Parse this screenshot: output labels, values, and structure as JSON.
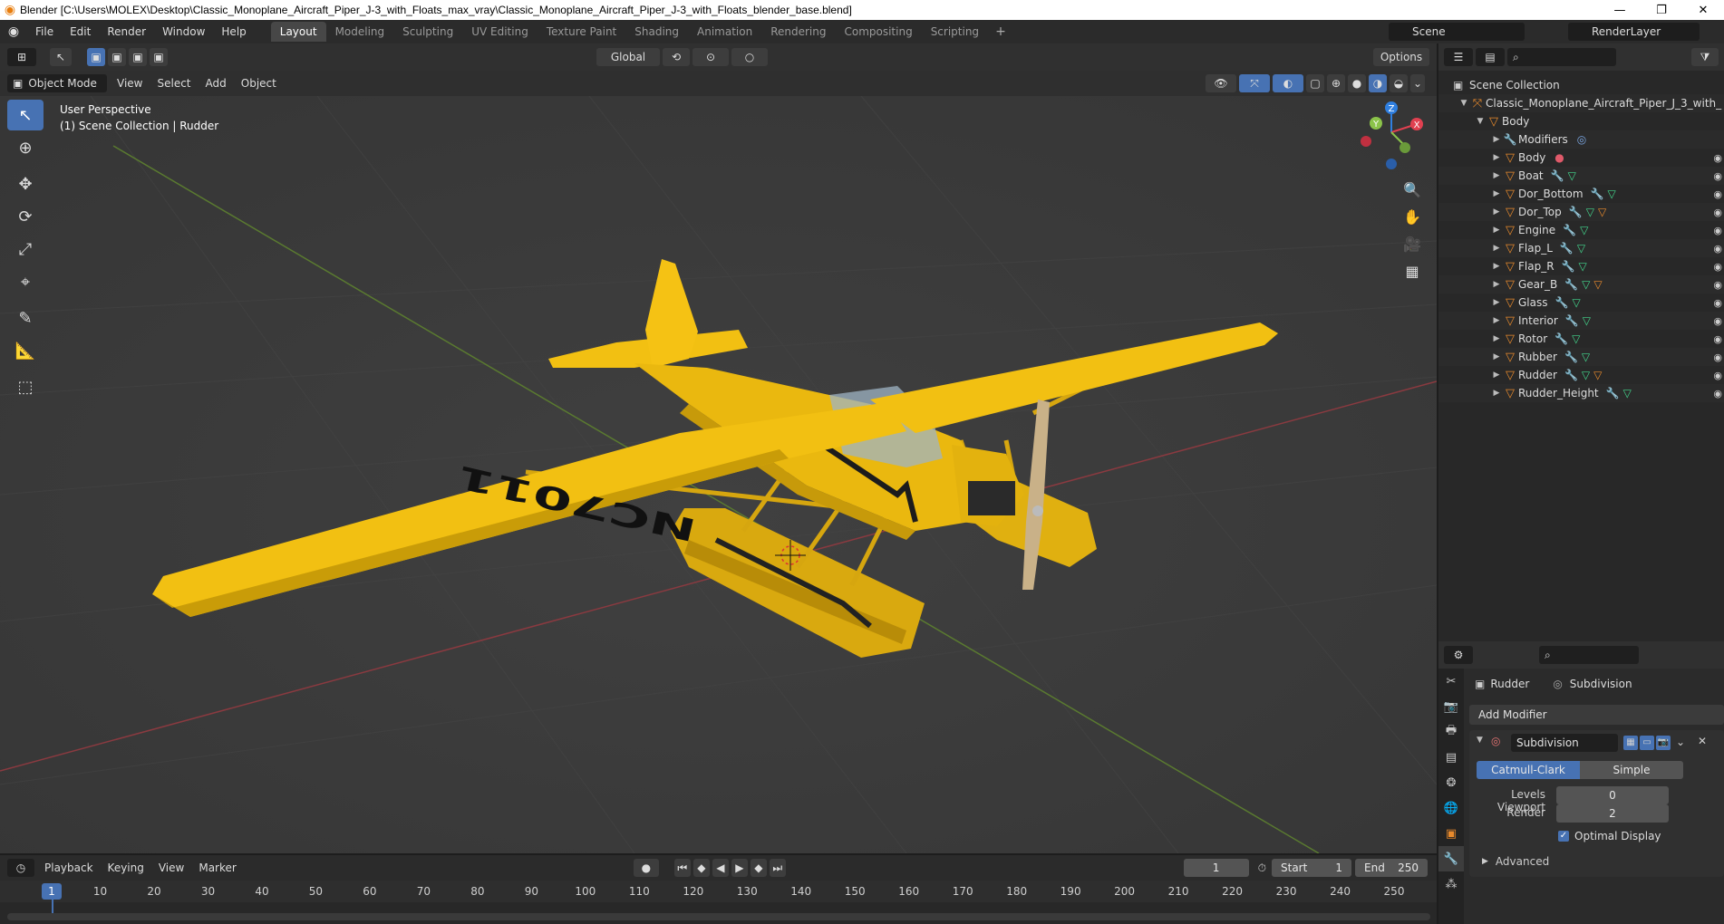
{
  "window": {
    "title": "Blender [C:\\Users\\MOLEX\\Desktop\\Classic_Monoplane_Aircraft_Piper_J-3_with_Floats_max_vray\\Classic_Monoplane_Aircraft_Piper_J-3_with_Floats_blender_base.blend]"
  },
  "menu": {
    "items": [
      "File",
      "Edit",
      "Render",
      "Window",
      "Help"
    ]
  },
  "workspaces": [
    "Layout",
    "Modeling",
    "Sculpting",
    "UV Editing",
    "Texture Paint",
    "Shading",
    "Animation",
    "Rendering",
    "Compositing",
    "Scripting"
  ],
  "scene": {
    "name": "Scene",
    "render_layer": "RenderLayer"
  },
  "toolbar": {
    "transform_orientation": "Global",
    "options": "Options"
  },
  "viewport_header": {
    "mode": "Object Mode",
    "menus": [
      "View",
      "Select",
      "Add",
      "Object"
    ]
  },
  "viewport": {
    "perspective": "User Perspective",
    "collection_info": "(1) Scene Collection | Rudder",
    "registration": "NC7011",
    "axes": {
      "x": "X",
      "y": "Y",
      "z": "Z"
    }
  },
  "timeline": {
    "menus": [
      "Playback",
      "Keying",
      "View",
      "Marker"
    ],
    "current_frame": "1",
    "start_label": "Start",
    "start": "1",
    "end_label": "End",
    "end": "250",
    "ticks": [
      "1",
      "10",
      "20",
      "30",
      "40",
      "50",
      "60",
      "70",
      "80",
      "90",
      "100",
      "110",
      "120",
      "130",
      "140",
      "150",
      "160",
      "170",
      "180",
      "190",
      "200",
      "210",
      "220",
      "230",
      "240",
      "250"
    ]
  },
  "outliner": {
    "root": "Scene Collection",
    "collection": "Classic_Monoplane_Aircraft_Piper_J_3_with_",
    "parent": "Body",
    "modifiers_label": "Modifiers",
    "children": [
      "Body",
      "Boat",
      "Dor_Bottom",
      "Dor_Top",
      "Engine",
      "Flap_L",
      "Flap_R",
      "Gear_B",
      "Glass",
      "Interior",
      "Rotor",
      "Rubber",
      "Rudder",
      "Rudder_Height"
    ]
  },
  "properties": {
    "object": "Rudder",
    "modifier_crumb": "Subdivision",
    "add_modifier": "Add Modifier",
    "modifier_name": "Subdivision",
    "catmull": "Catmull-Clark",
    "simple": "Simple",
    "levels_viewport_label": "Levels Viewport",
    "levels_viewport": "0",
    "render_label": "Render",
    "render": "2",
    "optimal_display": "Optimal Display",
    "advanced": "Advanced"
  },
  "colors": {
    "accent": "#4772b3",
    "plane_yellow": "#f2c012",
    "axis_x": "#e04050",
    "axis_y": "#8bc34a",
    "axis_z": "#2f7fe0"
  }
}
